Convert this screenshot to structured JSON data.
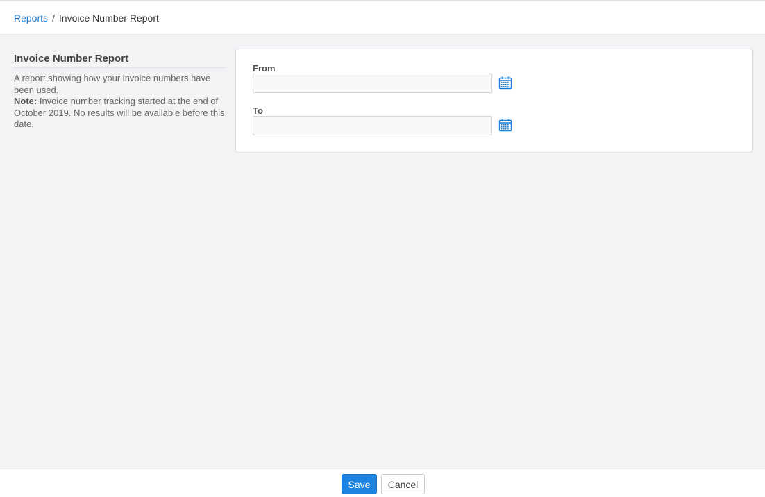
{
  "breadcrumb": {
    "parent": "Reports",
    "separator": "/",
    "current": "Invoice Number Report"
  },
  "sidebar": {
    "title": "Invoice Number Report",
    "description": "A report showing how your invoice numbers have been used.",
    "note_label": "Note:",
    "note_text": " Invoice number tracking started at the end of October 2019. No results will be available before this date."
  },
  "form": {
    "from": {
      "label": "From",
      "value": "",
      "icon": "calendar-icon"
    },
    "to": {
      "label": "To",
      "value": "",
      "icon": "calendar-icon"
    }
  },
  "footer": {
    "save_label": "Save",
    "cancel_label": "Cancel"
  },
  "colors": {
    "accent": "#1a84e0",
    "link": "#1a7bd8",
    "background": "#f2f3f5"
  }
}
